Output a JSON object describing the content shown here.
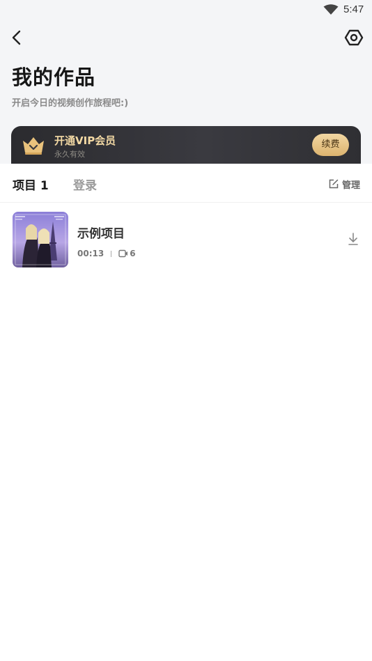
{
  "status_bar": {
    "time": "5:47",
    "wifi_icon": "wifi-icon"
  },
  "header": {
    "back_icon": "back-arrow-icon",
    "settings_icon": "hexagon-settings-icon",
    "title": "我的作品",
    "subtitle": "开启今日的视频创作旅程吧:)"
  },
  "vip_banner": {
    "icon": "crown-icon",
    "title": "开通VIP会员",
    "subtitle": "永久有效",
    "button_label": "续费",
    "accent_color": "#f3d9a4"
  },
  "tabs": [
    {
      "label": "项目 1",
      "selected": true
    },
    {
      "label": "登录",
      "selected": false
    }
  ],
  "manage": {
    "icon": "edit-icon",
    "label": "管理"
  },
  "projects": [
    {
      "name": "示例项目",
      "duration": "00:13",
      "clip_icon": "video-clip-icon",
      "clip_count": "6",
      "action_icon": "download-icon"
    }
  ]
}
